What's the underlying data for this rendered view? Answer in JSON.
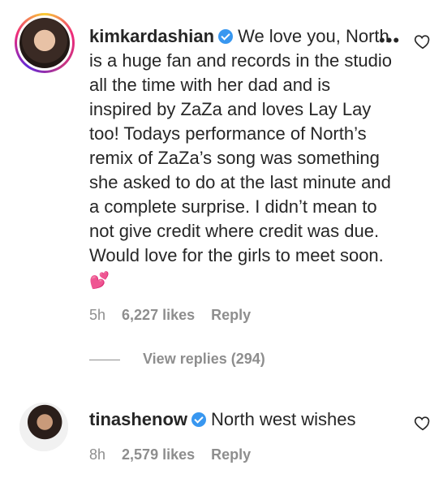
{
  "comments": [
    {
      "username": "kimkardashian",
      "verified": true,
      "text": "We love you, North is a huge fan and records in the studio all the time with her dad and is inspired by ZaZa and loves Lay Lay too! Todays performance of North’s remix of ZaZa’s song was something she asked to do at the last minute and a complete surprise. I didn’t mean to not give credit where credit was due. Would love for the girls to meet soon.",
      "emoji": "💕",
      "time": "5h",
      "likes": "6,227 likes",
      "reply_label": "Reply",
      "view_replies": "View replies (294)"
    },
    {
      "username": "tinashenow",
      "verified": true,
      "text": "North west wishes",
      "time": "8h",
      "likes": "2,579 likes",
      "reply_label": "Reply"
    }
  ],
  "icons": {
    "more": "more-options-icon",
    "heart": "heart-outline-icon",
    "verified": "verified-badge-icon"
  },
  "colors": {
    "verified": "#3897f0",
    "muted": "#8e8e8e",
    "text": "#262626"
  }
}
